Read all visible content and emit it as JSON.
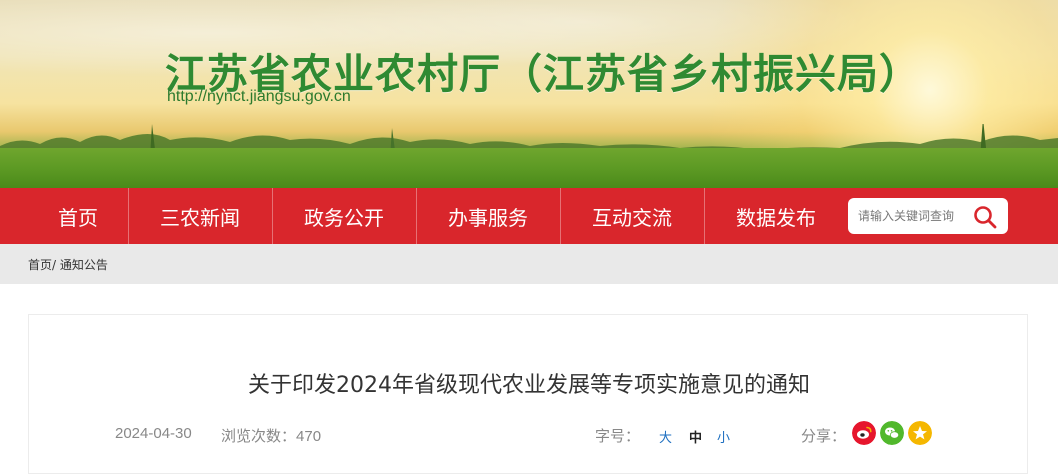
{
  "header": {
    "site_title": "江苏省农业农村厅（江苏省乡村振兴局）",
    "site_url": "http://nynct.jiangsu.gov.cn"
  },
  "nav": {
    "items": [
      "首页",
      "三农新闻",
      "政务公开",
      "办事服务",
      "互动交流",
      "数据发布"
    ],
    "search_placeholder": "请输入关键词查询"
  },
  "breadcrumb": {
    "home": "首页",
    "separator": "/",
    "current": "通知公告"
  },
  "article": {
    "title": "关于印发2024年省级现代农业发展等专项实施意见的通知",
    "date": "2024-04-30",
    "views_label": "浏览次数：",
    "views": "470",
    "font_size_label": "字号：",
    "font_sizes": [
      "大",
      "中",
      "小"
    ],
    "font_size_selected": "中",
    "share_label": "分享：",
    "share_icons": [
      "weibo-icon",
      "wechat-icon",
      "qzone-icon"
    ]
  },
  "colors": {
    "nav_bg": "#d9262c",
    "title_green": "#2f8a32",
    "weibo": "#e6162d",
    "wechat": "#51b82c",
    "qzone": "#f5b700"
  }
}
